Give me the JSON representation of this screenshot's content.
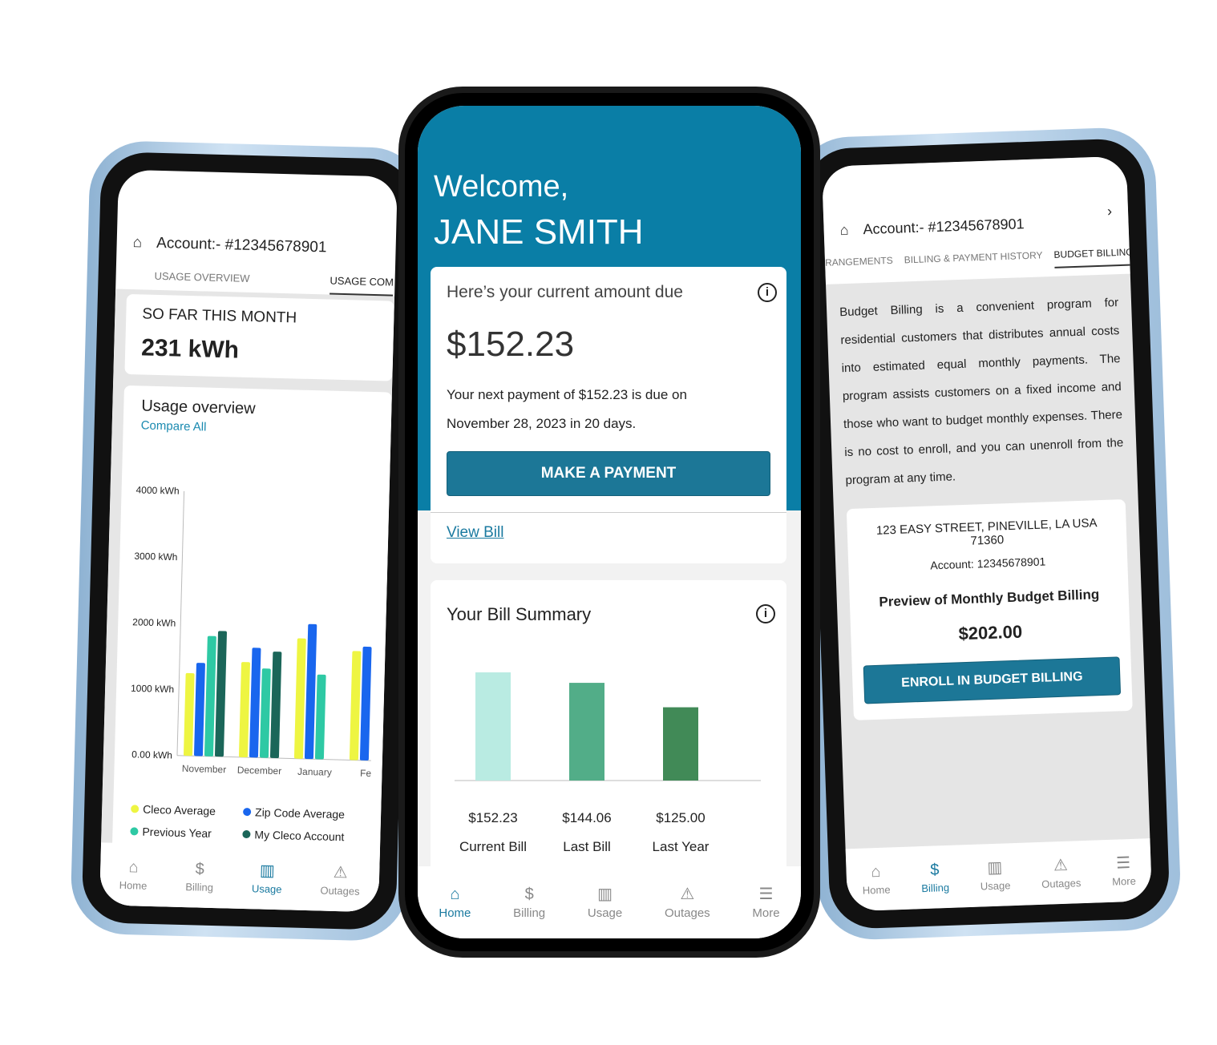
{
  "left": {
    "account": "Account:- #12345678901",
    "tabs": [
      "USAGE OVERVIEW",
      "USAGE COM"
    ],
    "so_far_label": "SO FAR THIS MONTH",
    "so_far_value": "231 kWh",
    "overview_title": "Usage overview",
    "compare_link": "Compare All",
    "chart_data": {
      "type": "bar",
      "categories": [
        "November",
        "December",
        "January",
        "Febr"
      ],
      "yticks": [
        "4000 kWh",
        "3000 kWh",
        "2000 kWh",
        "1000 kWh",
        "0.00 kWh"
      ],
      "ylim": [
        0,
        4000
      ],
      "series": [
        {
          "name": "Cleco Average",
          "color": "#eef542",
          "values": [
            1250,
            1440,
            1820,
            1650
          ]
        },
        {
          "name": "Zip Code Average",
          "color": "#1966ee",
          "values": [
            1410,
            1660,
            2040,
            1720
          ]
        },
        {
          "name": "Previous Year",
          "color": "#2ec9a4",
          "values": [
            1820,
            1350,
            1280,
            null
          ]
        },
        {
          "name": "My Cleco Account",
          "color": "#1b6659",
          "values": [
            1900,
            1610,
            null,
            null
          ]
        }
      ]
    },
    "nav": [
      {
        "label": "Home",
        "icon": "home-icon"
      },
      {
        "label": "Billing",
        "icon": "dollar-icon"
      },
      {
        "label": "Usage",
        "icon": "usage-chart-icon",
        "active": true
      },
      {
        "label": "Outages",
        "icon": "warning-icon"
      }
    ]
  },
  "center": {
    "welcome": "Welcome,",
    "name": "JANE SMITH",
    "amount_label": "Here’s your current amount due",
    "amount": "$152.23",
    "next_payment_line1": "Your next payment of $152.23  is due on",
    "next_payment_line2": "November 28, 2023 in 20 days.",
    "pay_button": "MAKE A PAYMENT",
    "view_bill": "View Bill",
    "summary_title": "Your Bill Summary",
    "chart_data": {
      "type": "bar",
      "categories": [
        "Current Bill",
        "Last Bill",
        "Last Year"
      ],
      "values": [
        152.23,
        144.06,
        125.0
      ],
      "labels": [
        "$152.23",
        "$144.06",
        "$125.00"
      ],
      "colors": [
        "#b9ebe2",
        "#52ad88",
        "#418a57"
      ]
    },
    "nav": [
      {
        "label": "Home",
        "icon": "home-icon",
        "active": true
      },
      {
        "label": "Billing",
        "icon": "dollar-icon"
      },
      {
        "label": "Usage",
        "icon": "usage-chart-icon"
      },
      {
        "label": "Outages",
        "icon": "warning-icon"
      },
      {
        "label": "More",
        "icon": "list-icon"
      }
    ]
  },
  "right": {
    "account": "Account:- #12345678901",
    "tabs": [
      "RANGEMENTS",
      "BILLING & PAYMENT HISTORY",
      "BUDGET BILLING"
    ],
    "description": "Budget Billing is a convenient program for residential customers that distributes annual costs into estimated equal monthly payments. The program assists customers on a fixed income and those who want to budget monthly expenses. There is no cost to enroll, and you can unenroll from the program at any time.",
    "address": "123 EASY STREET, PINEVILLE, LA USA 71360",
    "account_line": "Account:  12345678901",
    "preview_label": "Preview of Monthly Budget Billing",
    "preview_amount": "$202.00",
    "enroll_button": "ENROLL IN BUDGET BILLING",
    "nav": [
      {
        "label": "Home",
        "icon": "home-icon"
      },
      {
        "label": "Billing",
        "icon": "dollar-icon",
        "active": true
      },
      {
        "label": "Usage",
        "icon": "usage-chart-icon"
      },
      {
        "label": "Outages",
        "icon": "warning-icon"
      },
      {
        "label": "More",
        "icon": "list-icon"
      }
    ]
  }
}
